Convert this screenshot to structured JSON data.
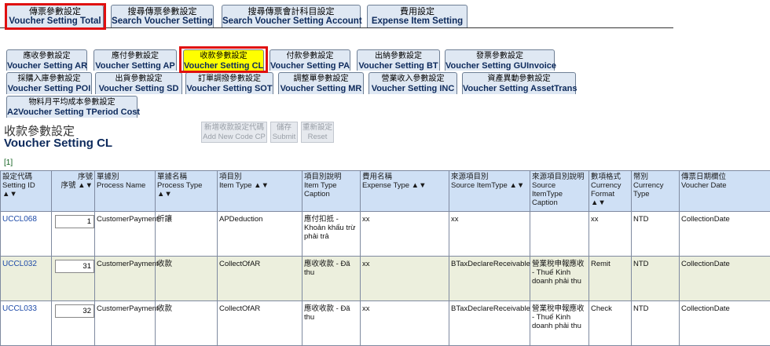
{
  "top_tabs": [
    {
      "zh": "傳票參數設定",
      "en": "Voucher Setting Total"
    },
    {
      "zh": "搜尋傳票參數設定",
      "en": "Search Voucher Setting"
    },
    {
      "zh": "搜尋傳票會計科目設定",
      "en": "Search Voucher Setting Account"
    },
    {
      "zh": "費用設定",
      "en": "Expense Item Setting"
    }
  ],
  "sub_tabs": [
    {
      "zh": "應收參數設定",
      "en": "Voucher Setting AR"
    },
    {
      "zh": "應付參數設定",
      "en": "Voucher Setting AP"
    },
    {
      "zh": "收款參數設定",
      "en": "Voucher Setting CL"
    },
    {
      "zh": "付款參數設定",
      "en": "Voucher Setting PA"
    },
    {
      "zh": "出納參數設定",
      "en": "Voucher Setting BT"
    },
    {
      "zh": "發票參數設定",
      "en": "Voucher Setting GUInvoice"
    },
    {
      "zh": "採購入庫參數設定",
      "en": "Voucher Setting POI"
    },
    {
      "zh": "出貨參數設定",
      "en": "Voucher Setting SD"
    },
    {
      "zh": "訂單調撥參數設定",
      "en": "Voucher Setting SOT"
    },
    {
      "zh": "調整單參數設定",
      "en": "Voucher Setting MR"
    },
    {
      "zh": "營業收入參數設定",
      "en": "Voucher Setting INC"
    },
    {
      "zh": "資產異動參數設定",
      "en": "Voucher Setting AssetTrans"
    },
    {
      "zh": "物料月平均成本參數設定",
      "en": "A2Voucher Setting TPeriod Cost"
    }
  ],
  "page_title": {
    "zh": "收款參數設定",
    "en": "Voucher Setting CL"
  },
  "buttons": {
    "add_new": {
      "zh": "新增收款設定代碼",
      "en": "Add New Code CP"
    },
    "submit": {
      "zh": "儲存",
      "en": "Submit"
    },
    "reset": {
      "zh": "重新設定",
      "en": "Reset"
    }
  },
  "pager": "[1]",
  "columns": [
    {
      "zh": "設定代碼",
      "en": "Setting ID ▲▼"
    },
    {
      "zh": "序號",
      "en": "序號 ▲▼"
    },
    {
      "zh": "單據別",
      "en": "Process Name"
    },
    {
      "zh": "單據名稱",
      "en": "Process Type ▲▼"
    },
    {
      "zh": "項目別",
      "en": "Item Type ▲▼"
    },
    {
      "zh": "項目別說明",
      "en": "Item Type Caption"
    },
    {
      "zh": "費用名稱",
      "en": "Expense Type ▲▼"
    },
    {
      "zh": "來源項目別",
      "en": "Source ItemType ▲▼"
    },
    {
      "zh": "來源項目別說明",
      "en": "Source ItemType Caption"
    },
    {
      "zh": "數項格式",
      "en": "Currency Format ▲▼"
    },
    {
      "zh": "幣別",
      "en": "Currency Type"
    },
    {
      "zh": "傳票日期欄位",
      "en": "Voucher Date"
    }
  ],
  "rows": [
    {
      "id": "UCCL068",
      "seq": "1",
      "process_name": "CustomerPayment",
      "process_type": "折讓",
      "item_type": "APDeduction",
      "item_caption": "應付扣抵 - Khoản khấu trừ phải trả",
      "expense_type": "xx",
      "source_item": "xx",
      "source_caption": "",
      "currency_format": "xx",
      "currency": "NTD",
      "voucher_date": "CollectionDate"
    },
    {
      "id": "UCCL032",
      "seq": "31",
      "process_name": "CustomerPayment",
      "process_type": "收款",
      "item_type": "CollectOfAR",
      "item_caption": "應收收款 - Đã thu",
      "expense_type": "xx",
      "source_item": "BTaxDeclareReceivable",
      "source_caption": "營業稅申報應收 - Thuế Kinh doanh phải thu",
      "currency_format": "Remit",
      "currency": "NTD",
      "voucher_date": "CollectionDate"
    },
    {
      "id": "UCCL033",
      "seq": "32",
      "process_name": "CustomerPayment",
      "process_type": "收款",
      "item_type": "CollectOfAR",
      "item_caption": "應收收款 - Đã thu",
      "expense_type": "xx",
      "source_item": "BTaxDeclareReceivable",
      "source_caption": "營業稅申報應收 - Thuế Kinh doanh phải thu",
      "currency_format": "Check",
      "currency": "NTD",
      "voucher_date": "CollectionDate"
    }
  ],
  "colors": {
    "active_tab": "#ffff00",
    "tab_bg": "#dfe8f3",
    "header_bg": "#cfe0f5",
    "alt_row": "#ecefdd",
    "highlight_box": "#e01010",
    "link": "#1d4aa8"
  }
}
